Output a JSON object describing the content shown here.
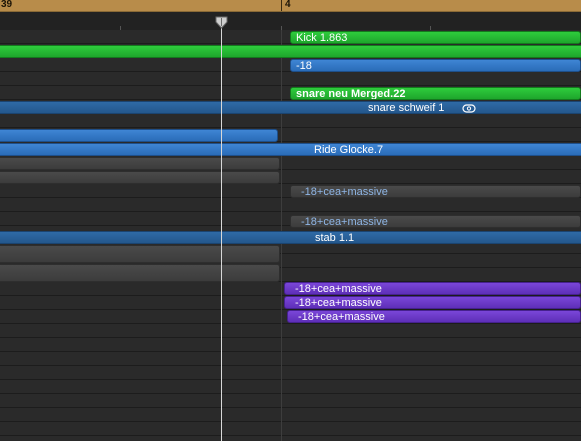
{
  "ruler": {
    "bar_numbers": [
      "39",
      "4"
    ]
  },
  "colors": {
    "ruler": "#b88c4a",
    "green": "#2ecc3c",
    "blue": "#3f85d4",
    "dark_blue": "#2f6aa6",
    "gray": "#444444",
    "purple": "#6b3ac8",
    "playhead": "#d8d8d8"
  },
  "regions": {
    "kick": "Kick  1.863",
    "blue_18": "-18",
    "snare_neu": "snare neu Merged.22",
    "snare_schweif": "snare schweif  1",
    "ride": "Ride Glocke.7",
    "massive_gray_1": "-18+cea+massive",
    "massive_gray_2": "-18+cea+massive",
    "stab": "stab  1.1",
    "massive_purple_1": "-18+cea+massive",
    "massive_purple_2": "-18+cea+massive",
    "massive_purple_3": "-18+cea+massive"
  },
  "icons": {
    "loop": "loop-icon",
    "playhead": "playhead-icon"
  }
}
